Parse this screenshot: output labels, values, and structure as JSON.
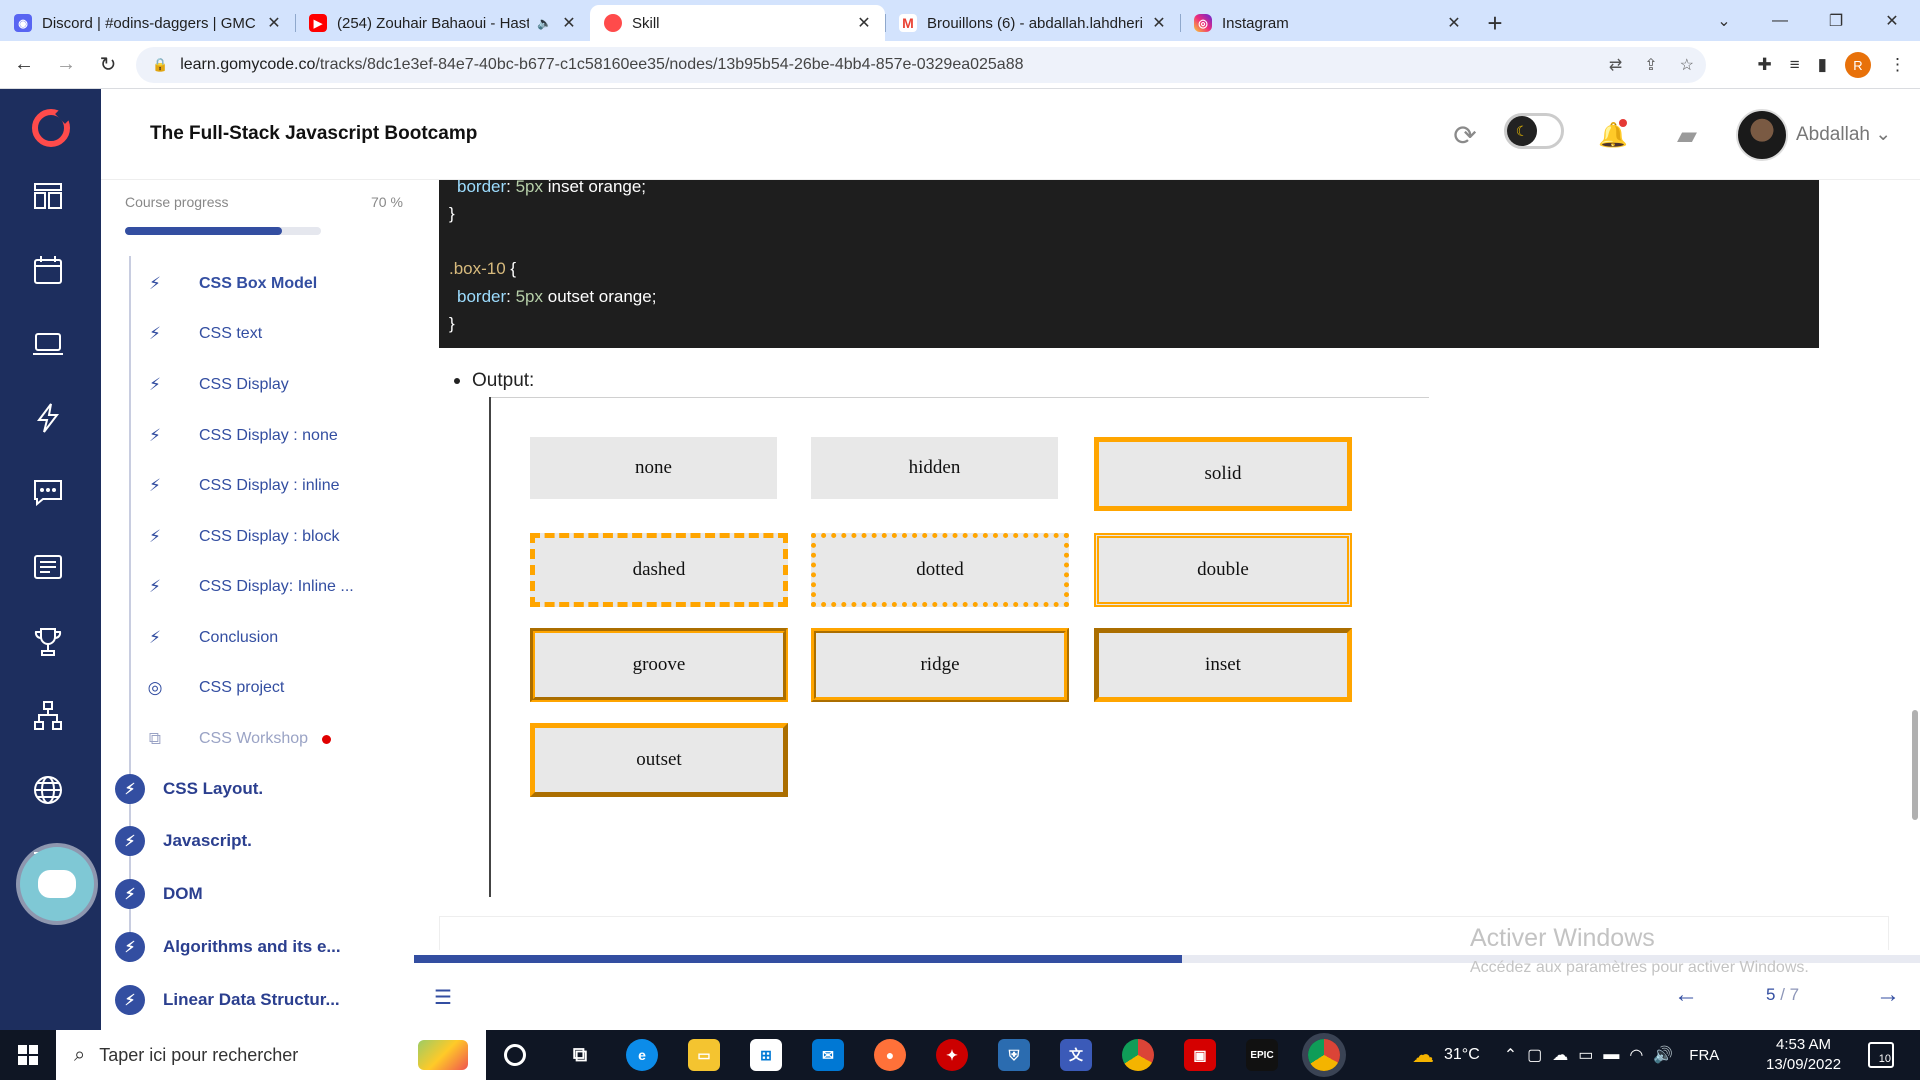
{
  "browser": {
    "tabs": [
      {
        "title": "Discord | #odins-daggers | GMC",
        "icon": "discord-icon",
        "color": "#5865f2"
      },
      {
        "title": "(254) Zouhair Bahaoui - Hast",
        "icon": "youtube-icon",
        "color": "#ff0000"
      },
      {
        "title": "Skill",
        "icon": "gomycode-icon",
        "color": "#ff4b4b"
      },
      {
        "title": "Brouillons (6) - abdallah.lahdheri",
        "icon": "gmail-icon",
        "color": "#ea4335"
      },
      {
        "title": "Instagram",
        "icon": "instagram-icon",
        "color": "#d62976"
      }
    ],
    "url_domain": "learn.gomycode.co",
    "url_path": "/tracks/8dc1e3ef-84e7-40bc-b677-c1c58160ee35/nodes/13b95b54-26be-4bb4-857e-0329ea025a88",
    "profile_initial": "R"
  },
  "header": {
    "course_title": "The Full-Stack Javascript Bootcamp",
    "username": "Abdallah"
  },
  "sidebar": {
    "progress_label": "Course progress",
    "progress_text": "70 %",
    "progress_fraction": 0.8,
    "lessons": [
      {
        "label": "CSS Box Model",
        "icon": "bolt-icon",
        "state": "current"
      },
      {
        "label": "CSS text",
        "icon": "bolt-icon",
        "state": "normal"
      },
      {
        "label": "CSS Display",
        "icon": "bolt-icon",
        "state": "normal"
      },
      {
        "label": "CSS Display : none",
        "icon": "bolt-icon",
        "state": "normal"
      },
      {
        "label": "CSS Display : inline",
        "icon": "bolt-icon",
        "state": "normal"
      },
      {
        "label": "CSS Display : block",
        "icon": "bolt-icon",
        "state": "normal"
      },
      {
        "label": "CSS Display: Inline ...",
        "icon": "bolt-icon",
        "state": "normal"
      },
      {
        "label": "Conclusion",
        "icon": "bolt-icon",
        "state": "normal"
      },
      {
        "label": "CSS project",
        "icon": "target-icon",
        "state": "normal"
      },
      {
        "label": "CSS Workshop",
        "icon": "workshop-icon",
        "state": "muted"
      }
    ],
    "chapters": [
      {
        "label": "CSS Layout."
      },
      {
        "label": "Javascript."
      },
      {
        "label": "DOM"
      },
      {
        "label": "Algorithms and its e..."
      },
      {
        "label": "Linear Data Structur..."
      }
    ]
  },
  "code": {
    "line1_prop": "border",
    "line1_num": "5px",
    "line1_rest": " inset orange;",
    "line2": "}",
    "line3_sel": ".box-10",
    "line3_brace": " {",
    "line4_prop": "border",
    "line4_num": "5px",
    "line4_rest": " outset orange;",
    "line5": "}"
  },
  "output": {
    "label": "Output:",
    "boxes": [
      "none",
      "hidden",
      "solid",
      "dashed",
      "dotted",
      "double",
      "groove",
      "ridge",
      "inset",
      "outset"
    ]
  },
  "lesson_nav": {
    "current_page": "5",
    "total_pages": "/ 7",
    "progress_fraction": 0.51
  },
  "watermark": {
    "line1": "Activer Windows",
    "line2": "Accédez aux paramètres pour activer Windows."
  },
  "taskbar": {
    "search_placeholder": "Taper ici pour rechercher",
    "temperature": "31°C",
    "language": "FRA",
    "time": "4:53 AM",
    "date": "13/09/2022",
    "notification_count": "10"
  },
  "colors": {
    "nav_bg": "#1d2e5e",
    "accent": "#334ea1",
    "brand": "#ff4b4b",
    "border_orange": "#ffa500"
  }
}
